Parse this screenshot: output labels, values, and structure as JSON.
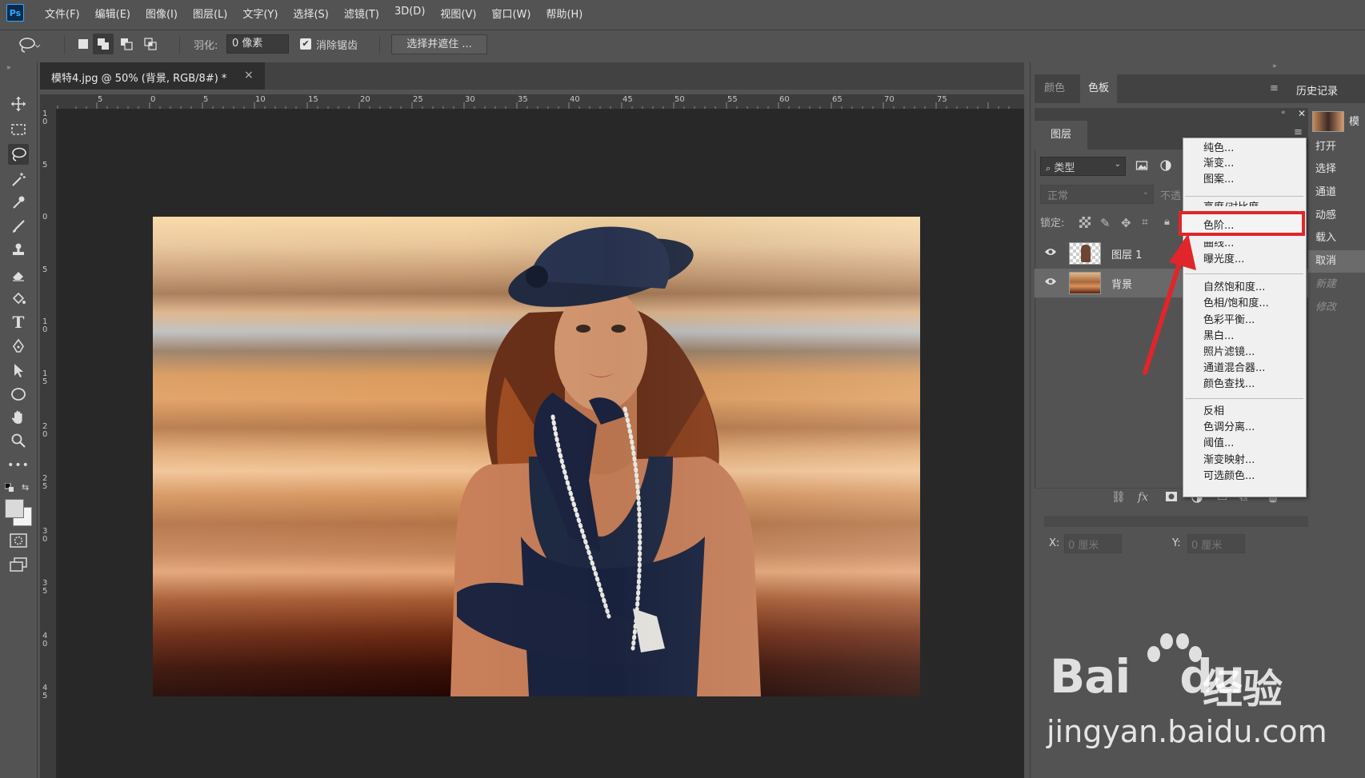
{
  "app": {
    "logo": "Ps"
  },
  "menu": [
    "文件(F)",
    "编辑(E)",
    "图像(I)",
    "图层(L)",
    "文字(Y)",
    "选择(S)",
    "滤镜(T)",
    "3D(D)",
    "视图(V)",
    "窗口(W)",
    "帮助(H)"
  ],
  "options": {
    "feather_label": "羽化:",
    "feather_value": "0 像素",
    "antialias_label": "消除锯齿",
    "antialias_checked": true,
    "select_mask_label": "选择并遮住 ..."
  },
  "document": {
    "tab_title": "模特4.jpg @ 50% (背景, RGB/8#) *",
    "close": "×"
  },
  "ruler": {
    "top_ticks": [
      "5",
      "0",
      "5",
      "10",
      "15",
      "20",
      "25",
      "30",
      "35",
      "40",
      "45",
      "50",
      "55",
      "60",
      "65",
      "70",
      "75"
    ],
    "left_ticks": [
      "1 0",
      "5",
      "0",
      "5",
      "1 0",
      "1 5",
      "2 0",
      "2 5",
      "3 0",
      "3 5",
      "4 0",
      "4 5"
    ]
  },
  "panels": {
    "color_tabs": [
      "颜色",
      "色板"
    ],
    "history": {
      "title": "历史记录",
      "snapshot_label": "模",
      "items": [
        "打开",
        "选择",
        "通道",
        "动感",
        "载入",
        "取消",
        "新建",
        "修改"
      ],
      "selected_index": 5
    },
    "layers": {
      "tab": "图层",
      "filter": "类型",
      "blend_mode": "正常",
      "opacity_label": "不透",
      "lock_label": "锁定:",
      "items": [
        {
          "name": "图层 1",
          "visible": true
        },
        {
          "name": "背景",
          "visible": true
        }
      ]
    },
    "properties": {
      "x_label": "X:",
      "x_value": "0 厘米",
      "y_label": "Y:",
      "y_value": "0 厘米"
    }
  },
  "adjustment_menu": {
    "groups": [
      [
        "纯色...",
        "渐变...",
        "图案..."
      ],
      [
        "亮度/对比度...",
        "色阶...",
        "曲线...",
        "曝光度..."
      ],
      [
        "自然饱和度...",
        "色相/饱和度...",
        "色彩平衡...",
        "黑白...",
        "照片滤镜...",
        "通道混合器...",
        "颜色查找..."
      ],
      [
        "反相",
        "色调分离...",
        "阈值...",
        "渐变映射...",
        "可选颜色..."
      ]
    ],
    "highlighted": "色阶..."
  },
  "watermark": {
    "logo_a": "Bai",
    "logo_b": "du",
    "cn": "经验",
    "url": "jingyan.baidu.com"
  },
  "colors": {
    "highlight": "#e0252b",
    "panel_bg": "#535353",
    "canvas_bg": "#282828"
  }
}
